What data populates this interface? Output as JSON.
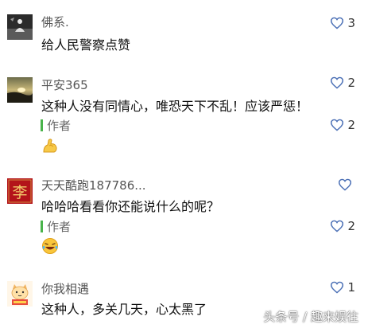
{
  "comments": [
    {
      "username": "佛系.",
      "text": "给人民警察点赞",
      "likes": "3",
      "avatar_icon": "meditation-avatar"
    },
    {
      "username": "平安365",
      "text": "这种人没有同情心，唯恐天下不乱！应该严惩！",
      "likes": "2",
      "avatar_icon": "sunset-avatar",
      "reply": {
        "label": "作者",
        "likes": "2",
        "emoji_icon": "flexed-arm-emoji"
      }
    },
    {
      "username": "天天酷跑187786...",
      "text": "哈哈哈看看你还能说什么的呢？",
      "likes": "",
      "avatar_icon": "red-seal-avatar",
      "avatar_text": "李",
      "reply": {
        "label": "作者",
        "likes": "2",
        "emoji_icon": "laughing-tears-emoji"
      }
    },
    {
      "username": "你我相遇",
      "text": "这种人，多关几天，心太黑了",
      "likes": "1",
      "avatar_icon": "cartoon-cat-avatar"
    }
  ],
  "watermark": "头条号 / 趣来娱往",
  "colors": {
    "accent_green": "#49b34b",
    "heart_stroke": "#4a6fb5",
    "text_main": "#111111",
    "text_muted": "#555555"
  }
}
